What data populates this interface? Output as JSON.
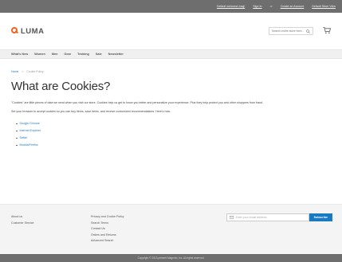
{
  "topbar": {
    "welcome_link": "Default welcome msg!",
    "signin_link": "Sign In",
    "or_text": "or",
    "create_account_link": "Create an Account",
    "store_link": "Default Store View"
  },
  "header": {
    "logo_text": "LUMA",
    "search_placeholder": "Search entire store here...",
    "brand_color": "#f26322"
  },
  "nav": {
    "items": [
      "What's New",
      "Women",
      "Men",
      "Gear",
      "Training",
      "Sale",
      "Newsletter"
    ]
  },
  "breadcrumbs": {
    "home": "Home",
    "separator": ">",
    "current": "Cookie Policy"
  },
  "main": {
    "title": "What are Cookies?",
    "paragraph1": "\"Cookies\" are little pieces of data we send when you visit our store. Cookies help us get to know you better and personalize your experience. Plus they help protect you and other shoppers from fraud.",
    "paragraph2": "Set your browser to accept cookies so you can buy items, save items, and receive customized recommendations. Here's how:",
    "browsers": [
      "Google Chrome",
      "Internet Explorer",
      "Safari",
      "Mozilla/Firefox"
    ]
  },
  "footer": {
    "col1": [
      "About us",
      "Customer Service"
    ],
    "col2": [
      "Privacy and Cookie Policy",
      "Search Terms",
      "Contact Us",
      "Orders and Returns",
      "Advanced Search"
    ],
    "newsletter_placeholder": "Enter your email address",
    "subscribe_label": "Subscribe",
    "accent_color": "#1979c3"
  },
  "copyright": "Copyright © 2013-present Magento, Inc. All rights reserved."
}
